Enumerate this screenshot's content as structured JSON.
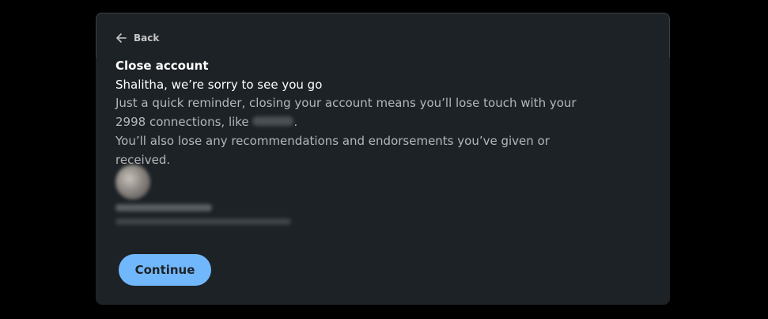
{
  "back": {
    "label": "Back",
    "icon": "arrow-left-icon"
  },
  "dialog": {
    "title": "Close account",
    "subtitle": "Shalitha, we’re sorry to see you go",
    "reminder_prefix": "Just a quick reminder, closing your account means you’ll lose touch with your 2998 connections, like ",
    "reminder_suffix": ".",
    "recommendations_note": "You’ll also lose any recommendations and endorsements you’ve given or received."
  },
  "actions": {
    "continue_label": "Continue"
  },
  "colors": {
    "page_background": "#000000",
    "card_background": "#1d2226",
    "primary_button": "#71b7fb",
    "muted_text": "#b4b7b9"
  }
}
